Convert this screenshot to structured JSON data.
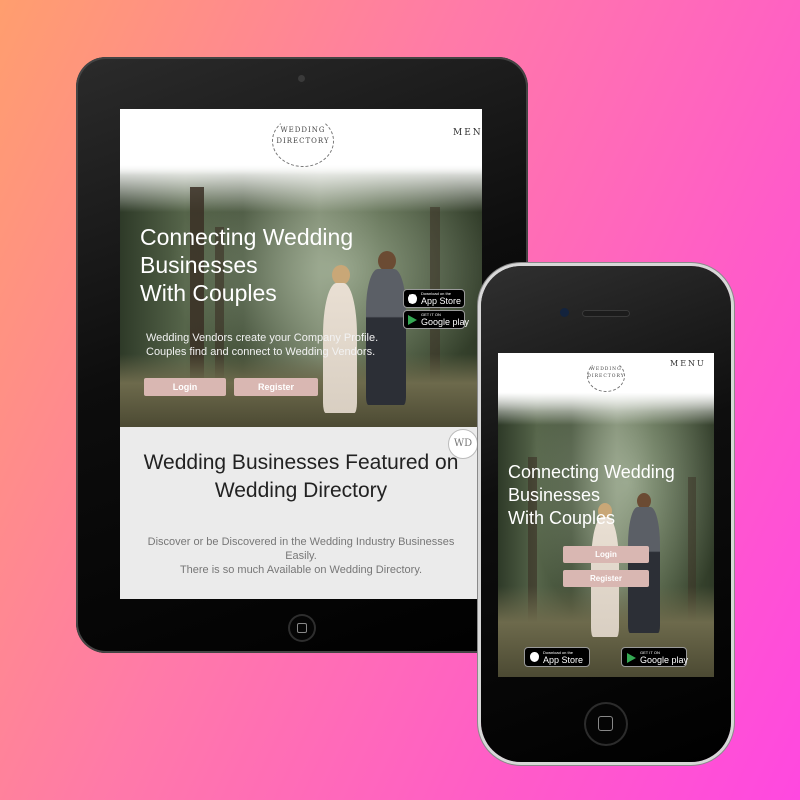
{
  "brand": {
    "logo_line1": "WEDDING",
    "logo_line2": "DIRECTORY",
    "badge": "WD"
  },
  "nav": {
    "menu_label": "MENU"
  },
  "hero": {
    "headline_line1": "Connecting Wedding",
    "headline_line2": "Businesses",
    "headline_line3": "With Couples",
    "sub_line1": "Wedding Vendors create your Company Profile.",
    "sub_line2": "Couples find and connect to Wedding Vendors.",
    "login_label": "Login",
    "register_label": "Register"
  },
  "app_badges": {
    "appstore_small": "Download on the",
    "appstore_big": "App Store",
    "googleplay_small": "GET IT ON",
    "googleplay_big": "Google play"
  },
  "featured": {
    "title_line1": "Wedding Businesses Featured on",
    "title_line2": "Wedding Directory",
    "desc_line1": "Discover or be Discovered in the Wedding Industry Businesses",
    "desc_line2": "Easily.",
    "desc_line3": "There is so much Available on Wedding Directory."
  },
  "colors": {
    "button_pink": "#d9b7b2",
    "background_start": "#ff9e6e",
    "background_end": "#ff48e0"
  }
}
